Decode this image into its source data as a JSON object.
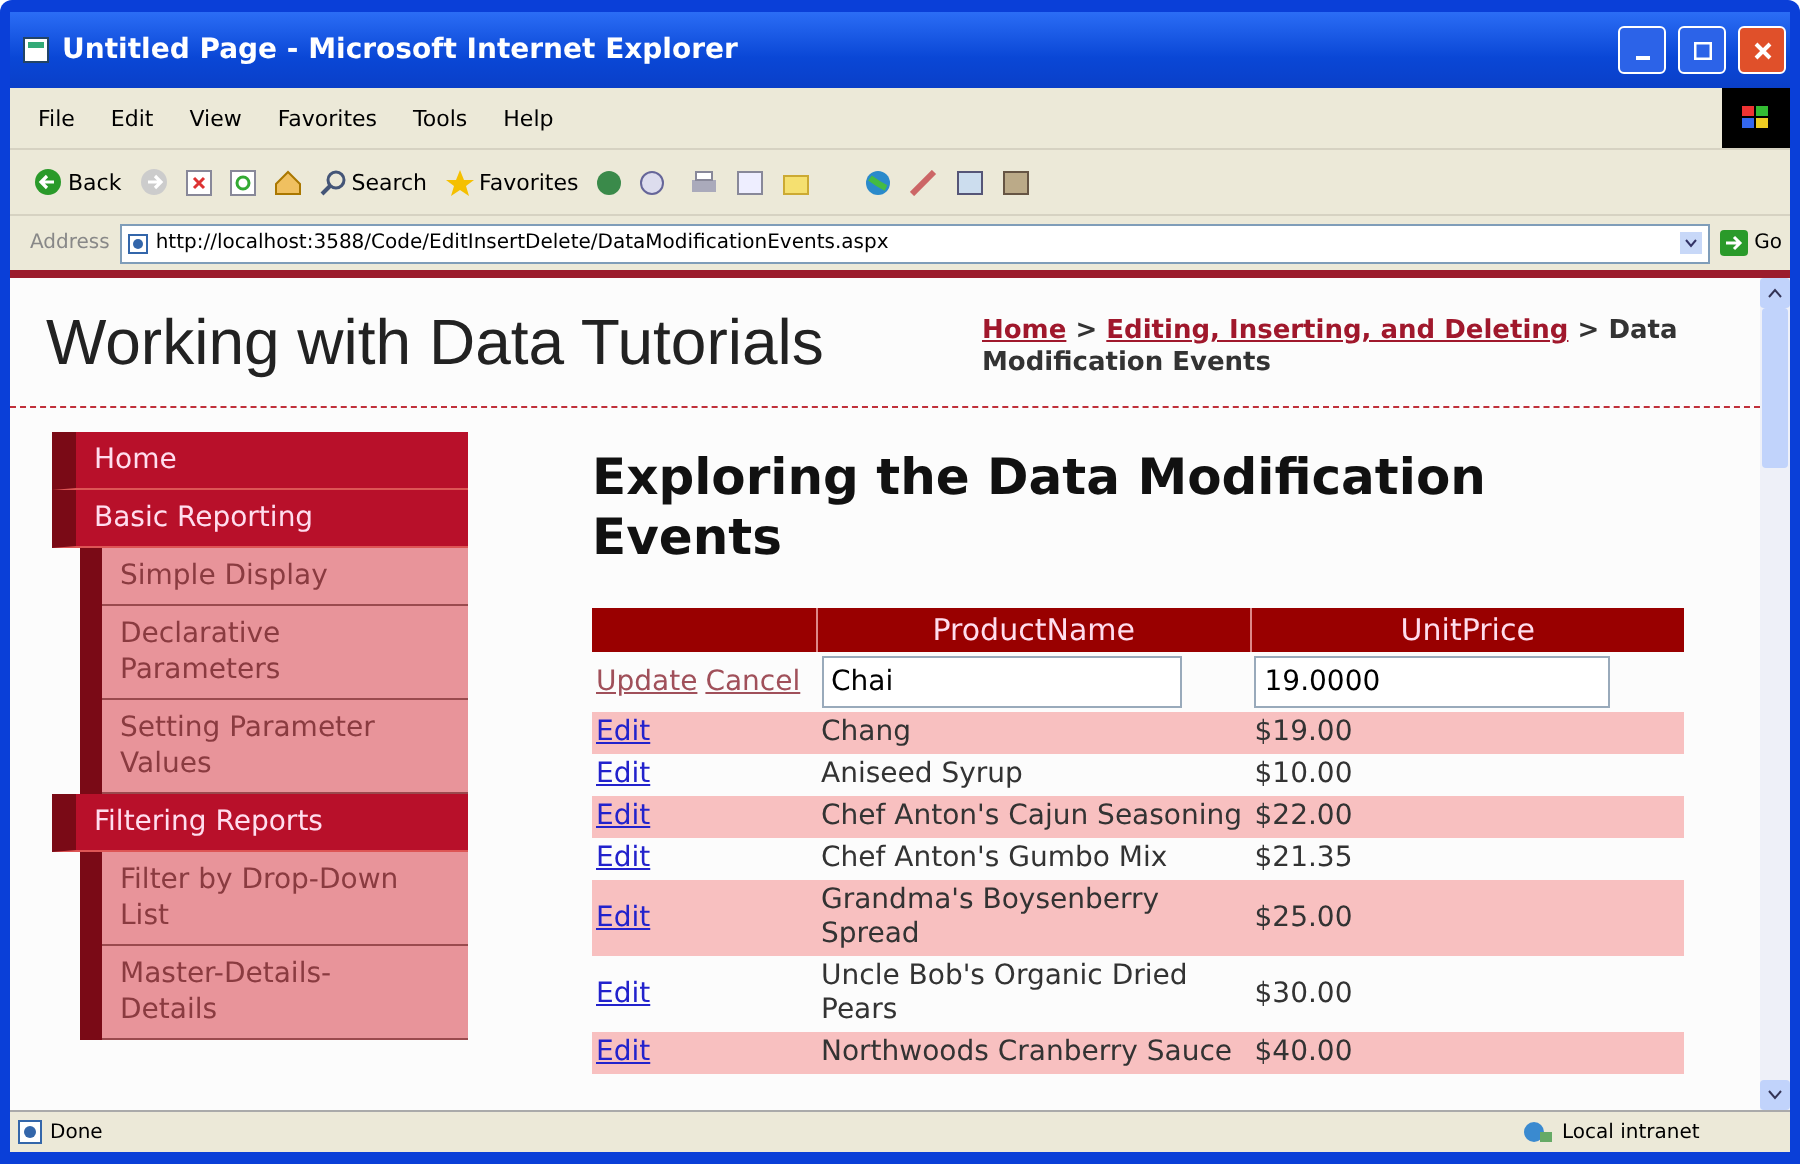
{
  "window": {
    "title": "Untitled Page - Microsoft Internet Explorer"
  },
  "menu": [
    "File",
    "Edit",
    "View",
    "Favorites",
    "Tools",
    "Help"
  ],
  "toolbar": {
    "back": "Back",
    "search": "Search",
    "favorites": "Favorites"
  },
  "address_bar": {
    "label": "Address",
    "url": "http://localhost:3588/Code/EditInsertDelete/DataModificationEvents.aspx",
    "go": "Go"
  },
  "page": {
    "site_title": "Working with Data Tutorials",
    "breadcrumb": [
      {
        "text": "Home",
        "kind": "link"
      },
      {
        "text": ">",
        "kind": "separator"
      },
      {
        "text": "Editing, Inserting, and Deleting",
        "kind": "link"
      },
      {
        "text": ">",
        "kind": "separator"
      },
      {
        "text": "Data Modification Events",
        "kind": "current"
      }
    ],
    "sidebar": {
      "items": [
        {
          "label": "Home"
        },
        {
          "label": "Basic Reporting",
          "children": [
            {
              "label": "Simple Display"
            },
            {
              "label": "Declarative Parameters"
            },
            {
              "label": "Setting Parameter Values"
            }
          ]
        },
        {
          "label": "Filtering Reports",
          "children": [
            {
              "label": "Filter by Drop-Down List"
            },
            {
              "label": "Master-Details-Details"
            }
          ]
        }
      ]
    },
    "heading": "Exploring the Data Modification Events",
    "table": {
      "columns": [
        "ProductName",
        "UnitPrice"
      ],
      "rows": [
        {
          "kind": "editing",
          "actions": [
            "Update",
            "Cancel"
          ],
          "product_name": "Chai",
          "unit_price": "19.0000"
        },
        {
          "kind": "display",
          "action": "Edit",
          "product_name": "Chang",
          "unit_price": "$19.00"
        },
        {
          "kind": "display",
          "action": "Edit",
          "product_name": "Aniseed Syrup",
          "unit_price": "$10.00"
        },
        {
          "kind": "display",
          "action": "Edit",
          "product_name": "Chef Anton's Cajun Seasoning",
          "unit_price": "$22.00"
        },
        {
          "kind": "display",
          "action": "Edit",
          "product_name": "Chef Anton's Gumbo Mix",
          "unit_price": "$21.35"
        },
        {
          "kind": "display",
          "action": "Edit",
          "product_name": "Grandma's Boysenberry Spread",
          "unit_price": "$25.00"
        },
        {
          "kind": "display",
          "action": "Edit",
          "product_name": "Uncle Bob's Organic Dried Pears",
          "unit_price": "$30.00"
        },
        {
          "kind": "display",
          "action": "Edit",
          "product_name": "Northwoods Cranberry Sauce",
          "unit_price": "$40.00"
        }
      ]
    }
  },
  "status_bar": {
    "text": "Done",
    "zone": "Local intranet"
  }
}
